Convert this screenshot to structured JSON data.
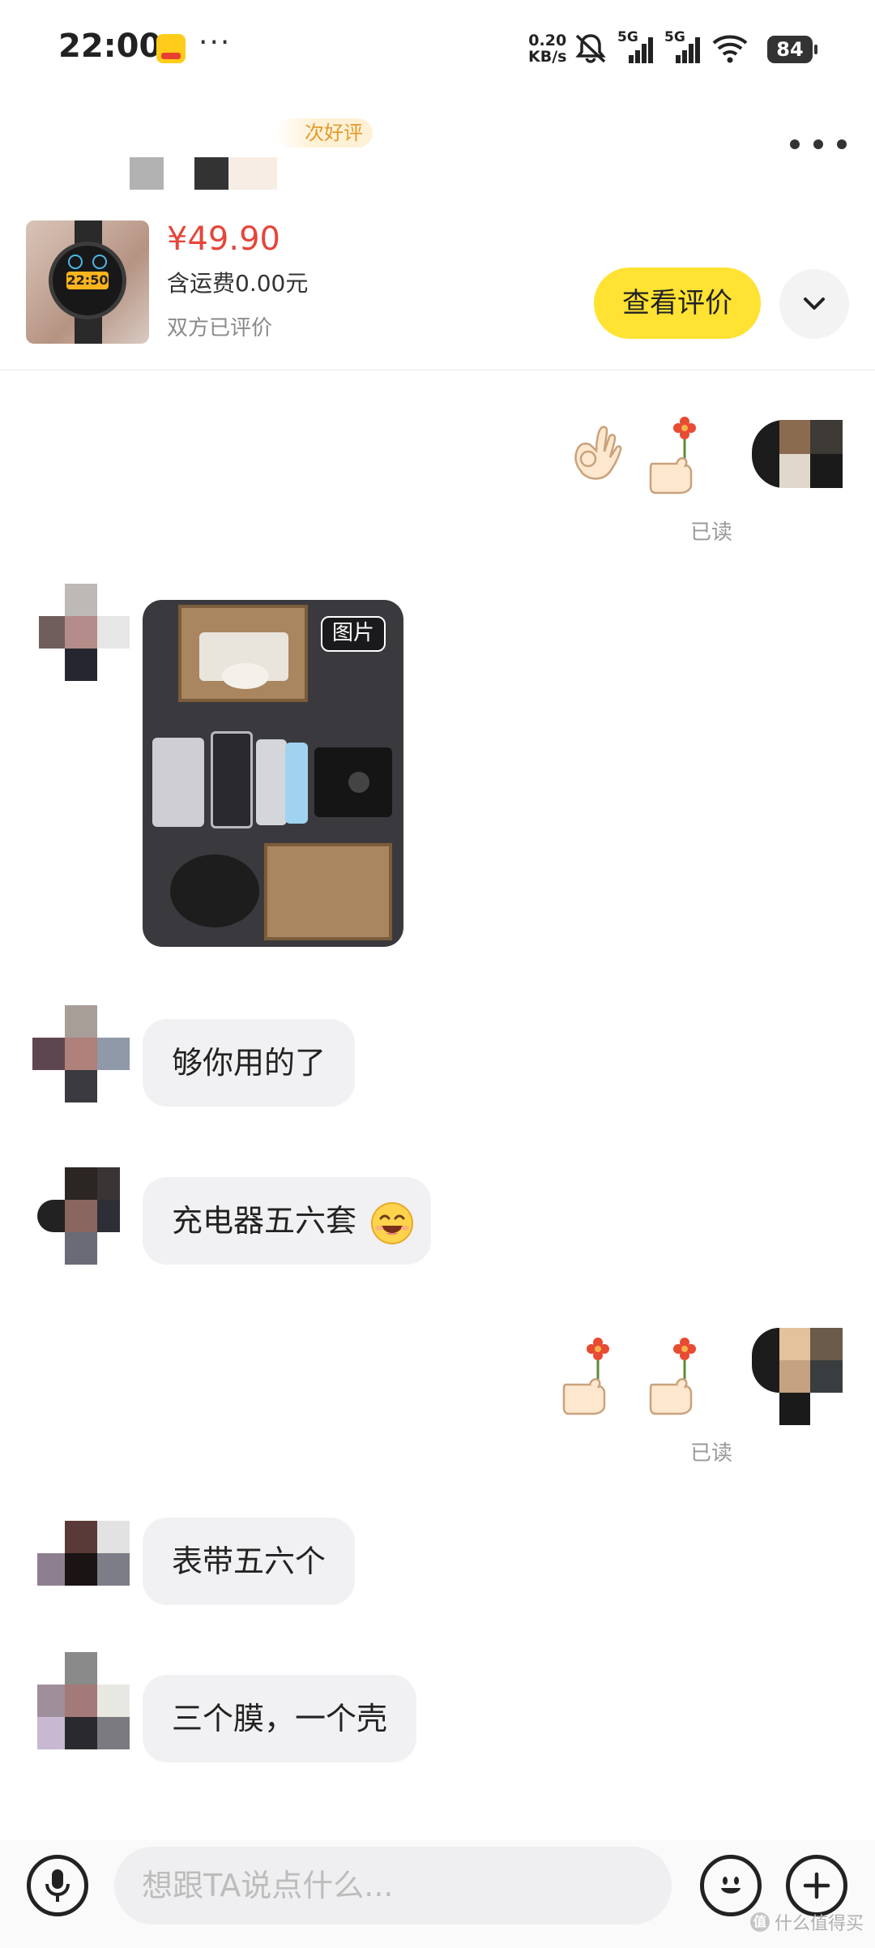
{
  "status_bar": {
    "time": "22:00",
    "more": "···",
    "net_speed_value": "0.20",
    "net_speed_unit": "KB/s",
    "signal_1": "5G",
    "signal_2": "5G",
    "battery": "84"
  },
  "header": {
    "review_tag": "次好评",
    "more_icon": "more-horizontal-icon"
  },
  "product": {
    "thumb_time": "22:50",
    "price": "¥49.90",
    "shipping": "含运费0.00元",
    "review_status": "双方已评价",
    "view_review_label": "查看评价",
    "expand_icon": "chevron-down-icon"
  },
  "messages": [
    {
      "side": "right",
      "type": "stickers",
      "stickers": [
        "ok-hand-sticker",
        "thumb-flower-sticker"
      ],
      "status": "已读"
    },
    {
      "side": "left",
      "type": "image",
      "badge": "图片"
    },
    {
      "side": "left",
      "type": "text",
      "text": "够你用的了"
    },
    {
      "side": "left",
      "type": "text",
      "text": "充电器五六套",
      "emoji": "grinning-emoji"
    },
    {
      "side": "right",
      "type": "stickers",
      "stickers": [
        "thumb-flower-sticker",
        "thumb-flower-sticker"
      ],
      "status": "已读"
    },
    {
      "side": "left",
      "type": "text",
      "text": "表带五六个"
    },
    {
      "side": "left",
      "type": "text",
      "text": "三个膜，一个壳"
    }
  ],
  "input_bar": {
    "placeholder": "想跟TA说点什么...",
    "value": ""
  },
  "watermark": {
    "text": "什么值得买",
    "badge": "值"
  },
  "colors": {
    "accent_yellow": "#ffe232",
    "price_red": "#e3473b",
    "bubble_gray": "#f1f1f3"
  }
}
